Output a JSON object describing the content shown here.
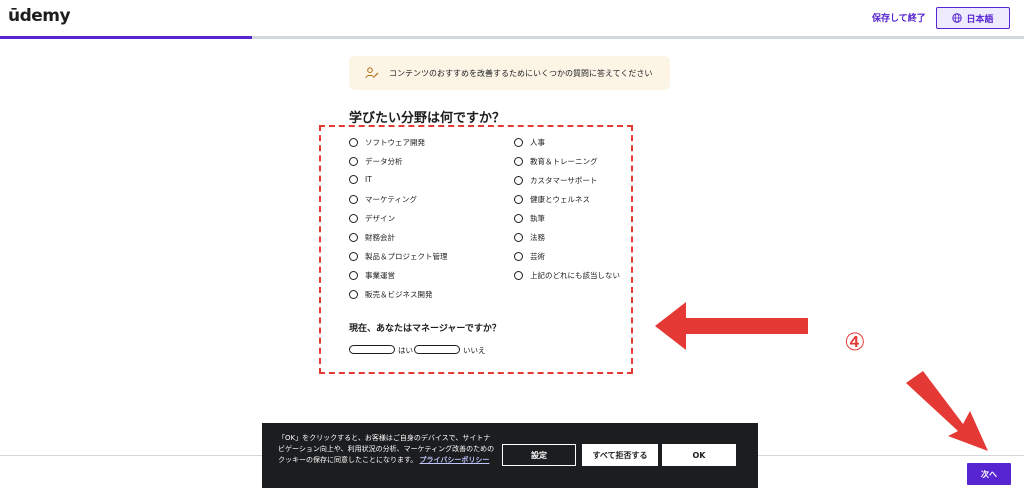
{
  "header": {
    "logo": "ūdemy",
    "save_and_exit": "保存して終了",
    "language": "日本語"
  },
  "progress": {
    "percent": 24.6
  },
  "banner": {
    "text": "コンテンツのおすすめを改善するためにいくつかの質問に答えてください"
  },
  "question": {
    "title": "学びたい分野は何ですか？",
    "options_left": [
      "ソフトウェア開発",
      "データ分析",
      "IT",
      "マーケティング",
      "デザイン",
      "財務会計",
      "製品＆プロジェクト管理",
      "事業運営",
      "販売＆ビジネス開発"
    ],
    "options_right": [
      "人事",
      "教育＆トレーニング",
      "カスタマーサポート",
      "健康とウェルネス",
      "執筆",
      "法務",
      "芸術",
      "上記のどれにも該当しない"
    ]
  },
  "manager": {
    "question": "現在、あなたはマネージャーですか？",
    "yes": "はい",
    "no": "いいえ"
  },
  "annotation": {
    "number": "④"
  },
  "cookie": {
    "text": "「OK」をクリックすると、お客様はご自身のデバイスで、サイトナビゲーション向上や、利用状況の分析、マーケティング改善のためのクッキーの保存に同意したことになります。",
    "link": "プライバシーポリシー",
    "settings": "設定",
    "reject_all": "すべて拒否する",
    "ok": "OK"
  },
  "footer": {
    "next": "次へ"
  },
  "colors": {
    "accent": "#5624d0",
    "annotation_red": "#e53935",
    "banner_bg": "#fcf5e6",
    "cookie_bg": "#1c1d1f"
  }
}
